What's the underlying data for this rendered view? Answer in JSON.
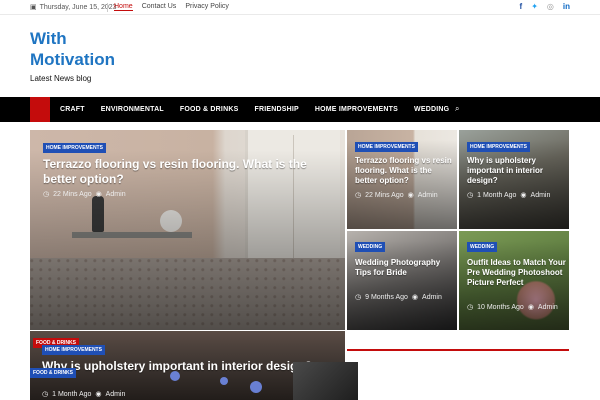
{
  "topbar": {
    "date": "Thursday, June 15, 2023",
    "links": [
      "Home",
      "Contact Us",
      "Privacy Policy"
    ],
    "social_icons": [
      "facebook-icon",
      "twitter-icon",
      "instagram-icon",
      "linkedin-icon"
    ]
  },
  "brand": {
    "title": "With Motivation",
    "tagline": "Latest News blog",
    "color": "#1f75c2"
  },
  "nav": {
    "items": [
      "CRAFT",
      "ENVIRONMENTAL",
      "FOOD & DRINKS",
      "FRIENDSHIP",
      "HOME IMPROVEMENTS",
      "WEDDING"
    ],
    "accent": "#c40c0c"
  },
  "featured": {
    "category": "HOME IMPROVEMENTS",
    "title": "Terrazzo flooring vs resin flooring. What is the better option?",
    "time": "22 Mins Ago",
    "author": "Admin"
  },
  "grid": [
    {
      "category": "HOME IMPROVEMENTS",
      "title": "Terrazzo flooring vs resin flooring. What is the better option?",
      "time": "22 Mins Ago",
      "author": "Admin"
    },
    {
      "category": "HOME IMPROVEMENTS",
      "title": "Why is upholstery important in interior design?",
      "time": "1 Month Ago",
      "author": "Admin"
    },
    {
      "category": "WEDDING",
      "title": "Wedding Photography Tips for Bride",
      "time": "9 Months Ago",
      "author": "Admin"
    },
    {
      "category": "WEDDING",
      "title": "Outfit Ideas to Match Your Pre Wedding Photoshoot Picture Perfect",
      "time": "10 Months Ago",
      "author": "Admin"
    }
  ],
  "lower": {
    "section_badge": "FOOD & DRINKS",
    "category": "HOME IMPROVEMENTS",
    "title": "Why is upholstery important in interior design?",
    "time": "1 Month Ago",
    "author": "Admin",
    "second_category": "FOOD & DRINKS"
  }
}
